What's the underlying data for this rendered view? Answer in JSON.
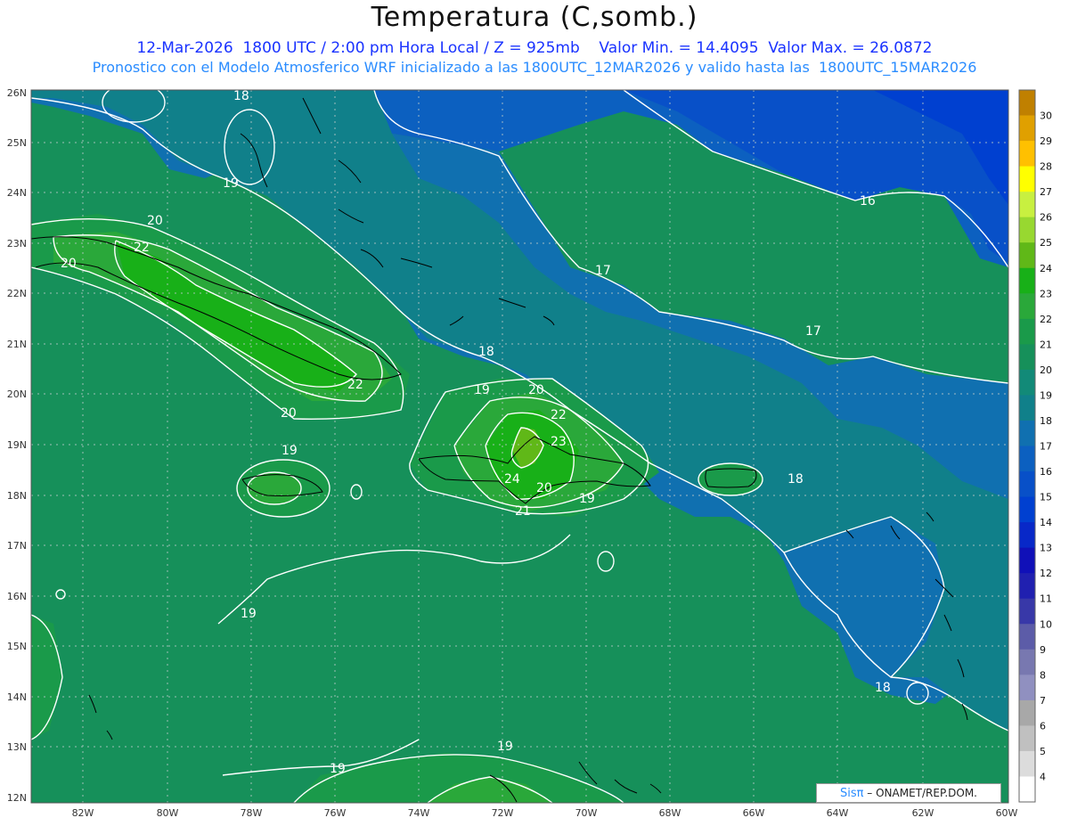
{
  "title": "Temperatura (C,somb.)",
  "subtitle_line1": "12-Mar-2026  1800 UTC / 2:00 pm Hora Local / Z = 925mb    Valor Min. = 14.4095  Valor Max. = 26.0872",
  "subtitle_line2": "Pronostico con el Modelo Atmosferico WRF inicializado a las 1800UTC_12MAR2026 y valido hasta las  1800UTC_15MAR2026",
  "credit": {
    "brand": "Sisπ",
    "text": " – ONAMET/REP.DOM."
  },
  "axes": {
    "lat_labels": [
      "26N",
      "25N",
      "24N",
      "23N",
      "22N",
      "21N",
      "20N",
      "19N",
      "18N",
      "17N",
      "16N",
      "15N",
      "14N",
      "13N",
      "12N"
    ],
    "lon_labels": [
      "82W",
      "80W",
      "78W",
      "76W",
      "74W",
      "72W",
      "70W",
      "68W",
      "66W",
      "64W",
      "62W",
      "60W"
    ],
    "lat_range": [
      11.9,
      26.1
    ],
    "lon_range": [
      -83.2,
      -60.0
    ],
    "grid": "dotted"
  },
  "colorbar": {
    "labels": [
      "30",
      "29",
      "28",
      "27",
      "26",
      "25",
      "24",
      "23",
      "22",
      "21",
      "20",
      "19",
      "18",
      "17",
      "16",
      "15",
      "14",
      "13",
      "12",
      "11",
      "10",
      "9",
      "8",
      "7",
      "6",
      "5",
      "4"
    ],
    "colors": [
      "#c08000",
      "#e0a000",
      "#ffc000",
      "#ffff00",
      "#c8f040",
      "#98d830",
      "#60b818",
      "#18b018",
      "#2aa83a",
      "#1a9a4a",
      "#16905a",
      "#128a78",
      "#10808a",
      "#1070b0",
      "#0c60c0",
      "#0850c8",
      "#0040d0",
      "#0828c8",
      "#1010b8",
      "#2020b0",
      "#3838a8",
      "#5c5ca8",
      "#7878b0",
      "#9090c0",
      "#a8a8a8",
      "#c0c0c0",
      "#dcdcdc",
      "#ffffff"
    ]
  },
  "contour_labels": [
    "18",
    "16",
    "17",
    "17",
    "20",
    "22",
    "20",
    "18",
    "19",
    "20",
    "22",
    "23",
    "24",
    "21",
    "20",
    "19",
    "20",
    "22",
    "19",
    "18",
    "19",
    "19",
    "18",
    "19",
    "19"
  ],
  "fields": {
    "min_value": 14.4095,
    "max_value": 26.0872
  }
}
